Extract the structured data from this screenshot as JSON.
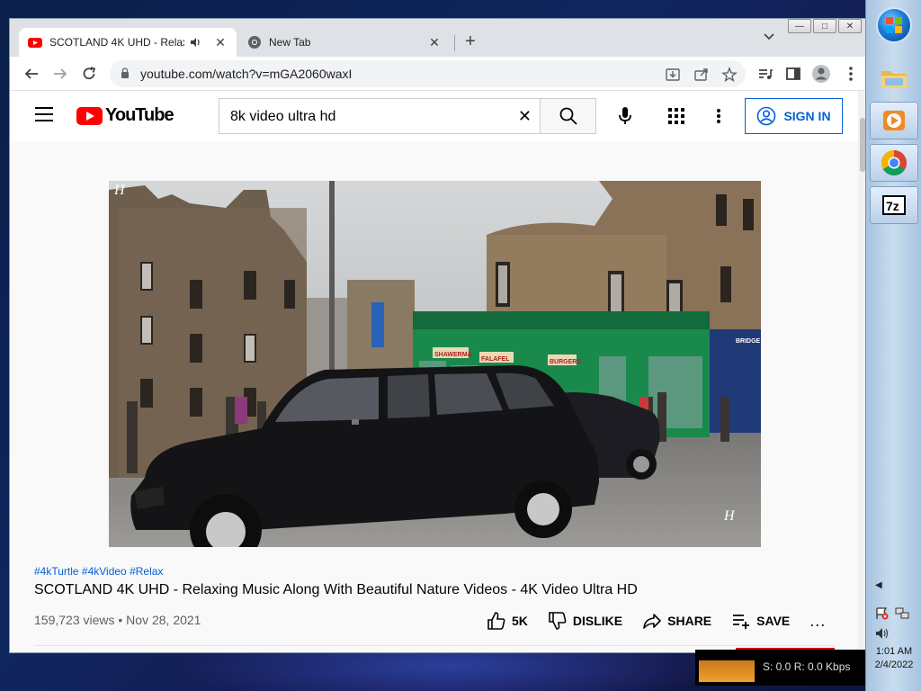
{
  "browser": {
    "tabs": [
      {
        "title": "SCOTLAND 4K UHD - Relaxi",
        "active": true
      },
      {
        "title": "New Tab",
        "active": false
      }
    ],
    "url": "youtube.com/watch?v=mGA2060waxI",
    "new_tab_symbol": "+",
    "tab_search_symbol": "⌄"
  },
  "youtube": {
    "logo_text": "YouTube",
    "search_query": "8k video ultra hd",
    "sign_in_label": "SIGN IN",
    "video": {
      "hashtags": "#4kTurtle #4kVideo #Relax",
      "title": "SCOTLAND 4K UHD - Relaxing Music Along With Beautiful Nature Videos - 4K Video Ultra HD",
      "views_date": "159,723 views • Nov 28, 2021",
      "like_count": "5K",
      "dislike_label": "DISLIKE",
      "share_label": "SHARE",
      "save_label": "SAVE",
      "more_label": "...",
      "watermark": "H",
      "shop_signs": [
        "SHAWERMA",
        "FALAFEL",
        "BURGERS",
        "BRIDGE"
      ]
    }
  },
  "tray": {
    "time": "1:01 AM",
    "date": "2/4/2022",
    "net_meter": "S: 0.0 R: 0.0 Kbps"
  },
  "colors": {
    "yt_red": "#ff0000",
    "yt_blue": "#065fd4",
    "chrome_frame": "#dee1e6"
  }
}
